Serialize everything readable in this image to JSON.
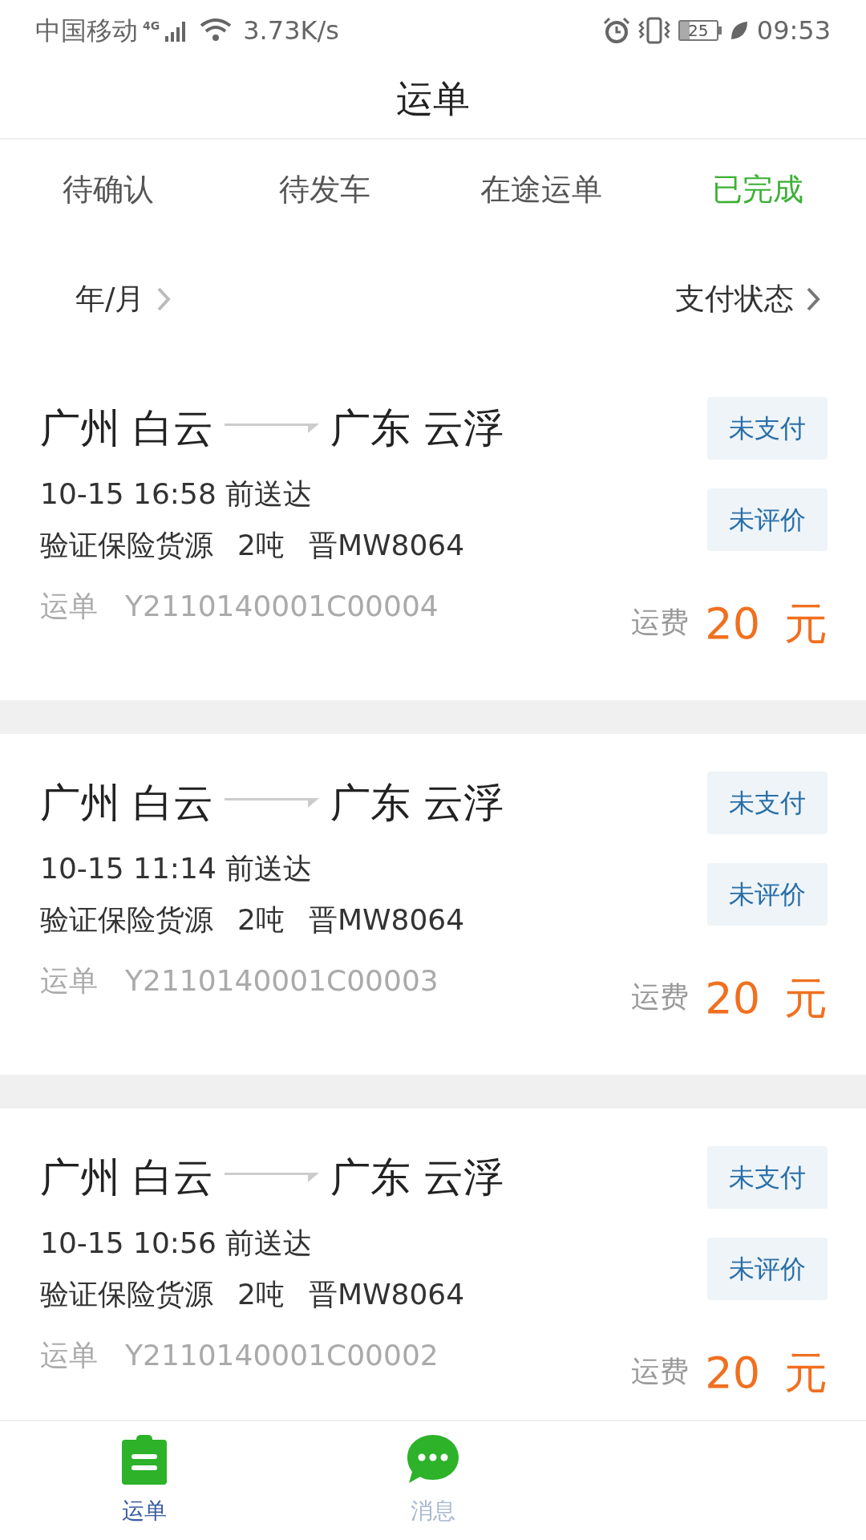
{
  "status_bar": {
    "carrier": "中国移动",
    "network": "4G",
    "speed": "3.73K/s",
    "battery": "25",
    "time": "09:53"
  },
  "header": {
    "title": "运单"
  },
  "tabs": [
    {
      "label": "待确认",
      "selected": false
    },
    {
      "label": "待发车",
      "selected": false
    },
    {
      "label": "在途运单",
      "selected": false
    },
    {
      "label": "已完成",
      "selected": true
    }
  ],
  "filters": {
    "date": "年/月",
    "payment": "支付状态"
  },
  "orders": [
    {
      "from": "广州 白云",
      "to": "广东 云浮",
      "deadline": "10-15 16:58 前送达",
      "cargo": "验证保险货源",
      "weight": "2吨",
      "plate": "晋MW8064",
      "order_label": "运单",
      "order_no": "Y2110140001C00004",
      "fee_label": "运费",
      "fee": "20",
      "unit": "元",
      "badges": [
        "未支付",
        "未评价"
      ]
    },
    {
      "from": "广州 白云",
      "to": "广东 云浮",
      "deadline": "10-15 11:14 前送达",
      "cargo": "验证保险货源",
      "weight": "2吨",
      "plate": "晋MW8064",
      "order_label": "运单",
      "order_no": "Y2110140001C00003",
      "fee_label": "运费",
      "fee": "20",
      "unit": "元",
      "badges": [
        "未支付",
        "未评价"
      ]
    },
    {
      "from": "广州 白云",
      "to": "广东 云浮",
      "deadline": "10-15 10:56 前送达",
      "cargo": "验证保险货源",
      "weight": "2吨",
      "plate": "晋MW8064",
      "order_label": "运单",
      "order_no": "Y2110140001C00002",
      "fee_label": "运费",
      "fee": "20",
      "unit": "元",
      "badges": [
        "未支付",
        "未评价"
      ]
    }
  ],
  "bottom_nav": [
    {
      "kind": "waybill",
      "label": "运单",
      "selected": true
    },
    {
      "kind": "messages",
      "label": "消息",
      "selected": false
    }
  ]
}
